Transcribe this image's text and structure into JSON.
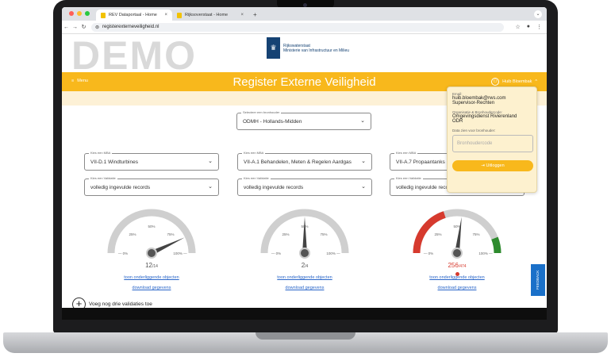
{
  "browser": {
    "tabs": [
      {
        "label": "REV Dataportaal - Home"
      },
      {
        "label": "Rijksoverstaat - Home"
      }
    ],
    "url": "registerexterneveiligheid.nl"
  },
  "header": {
    "watermark": "DEMO",
    "logo_line1": "Rijkswaterstaat",
    "logo_line2": "Ministerie van Infrastructuur en Milieu"
  },
  "banner": {
    "menu_label": "Menu",
    "title": "Register Externe Veiligheid",
    "user_name": "Huib Bloembak"
  },
  "bronhouder": {
    "label": "Selecteer een bronhouder",
    "value": "ODMH - Hollands-Midden"
  },
  "columns": [
    {
      "mba_label": "Kies een MBA",
      "mba_value": "VII-D.1 Windturbines",
      "validatie_label": "Kies een Validatie",
      "validatie_value": "volledig ingevulde records",
      "gauge_value": "12",
      "gauge_total": "/14",
      "link1": "toon onderliggende objecten",
      "link2": "download gegevens",
      "colored": false,
      "needle_fraction": 0.86
    },
    {
      "mba_label": "Kies een MBA",
      "mba_value": "VII-A.1 Behandelen, Meten & Regelen Aardgas",
      "validatie_label": "Kies een Validatie",
      "validatie_value": "volledig ingevulde records",
      "gauge_value": "2",
      "gauge_total": "/4",
      "link1": "toon onderliggende objecten",
      "link2": "download gegevens",
      "colored": false,
      "needle_fraction": 0.5
    },
    {
      "mba_label": "Kies een MBA",
      "mba_value": "VII-A.7 Propaantanks",
      "validatie_label": "Kies een Validatie",
      "validatie_value": "volledig ingevulde records",
      "gauge_value": "256",
      "gauge_total": "/474",
      "link1": "toon onderliggende objecten",
      "link2": "download gegevens",
      "colored": true,
      "needle_fraction": 0.54
    }
  ],
  "gauge_ticks": {
    "t0": "0%",
    "t25": "25%",
    "t50": "50%",
    "t75": "75%",
    "t100": "100%"
  },
  "add_label": "Voeg nog drie validaties toe",
  "feedback_label": "FEEDBACK",
  "popup": {
    "email_label": "Email:",
    "email": "huib.bloembak@rws.com",
    "role": "Supervisor-Rechten",
    "org_label": "Organisatie & Bronhoudercode:",
    "org": "Omgevingsdienst Rivierenland",
    "code": "ODR",
    "data_label": "Data zien voor bronhouder:",
    "input_placeholder": "Bronhoudercode",
    "logout_label": "Uitloggen"
  },
  "colors": {
    "accent": "#f8b81c",
    "red": "#d63a2e",
    "green": "#2e8b2e",
    "link": "#2a66c9"
  }
}
